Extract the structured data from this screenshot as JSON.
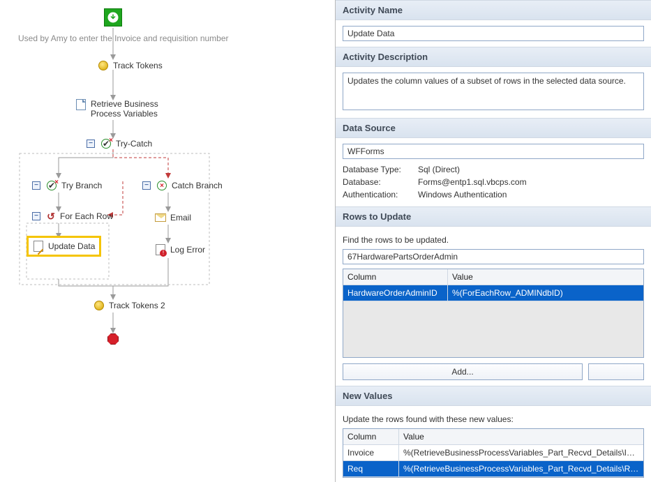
{
  "canvas": {
    "hint": "Used by Amy to enter the Invoice and requisition number",
    "start": "",
    "nodes": {
      "track_tokens": "Track Tokens",
      "retrieve_vars": "Retrieve Business Process Variables",
      "try_catch": "Try-Catch",
      "try_branch": "Try Branch",
      "for_each_row": "For Each Row",
      "update_data": "Update Data",
      "catch_branch": "Catch Branch",
      "email": "Email",
      "log_error": "Log Error",
      "track_tokens_2": "Track Tokens 2"
    }
  },
  "panel": {
    "activity_name": {
      "header": "Activity Name",
      "value": "Update Data"
    },
    "activity_description": {
      "header": "Activity Description",
      "value": "Updates the column values of a subset of rows in the selected data source."
    },
    "data_source": {
      "header": "Data Source",
      "value": "WFForms",
      "db_type_label": "Database Type:",
      "db_type_value": "Sql (Direct)",
      "db_label": "Database:",
      "db_value": "Forms@entp1.sql.vbcps.com",
      "auth_label": "Authentication:",
      "auth_value": "Windows Authentication"
    },
    "rows_to_update": {
      "header": "Rows to Update",
      "hint": "Find the rows to be updated.",
      "table_name": "67HardwarePartsOrderAdmin",
      "col_header": "Column",
      "val_header": "Value",
      "rows": [
        {
          "column": "HardwareOrderAdminID",
          "value": "%(ForEachRow_ADMINdbID)"
        }
      ],
      "add_label": "Add...",
      "secondary_label": ""
    },
    "new_values": {
      "header": "New Values",
      "hint": "Update the rows found with these new values:",
      "col_header": "Column",
      "val_header": "Value",
      "rows": [
        {
          "column": "Invoice",
          "value": "%(RetrieveBusinessProcessVariables_Part_Recvd_Details\\Invoice)"
        },
        {
          "column": "Req",
          "value": "%(RetrieveBusinessProcessVariables_Part_Recvd_Details\\Requisition__)"
        }
      ]
    }
  }
}
